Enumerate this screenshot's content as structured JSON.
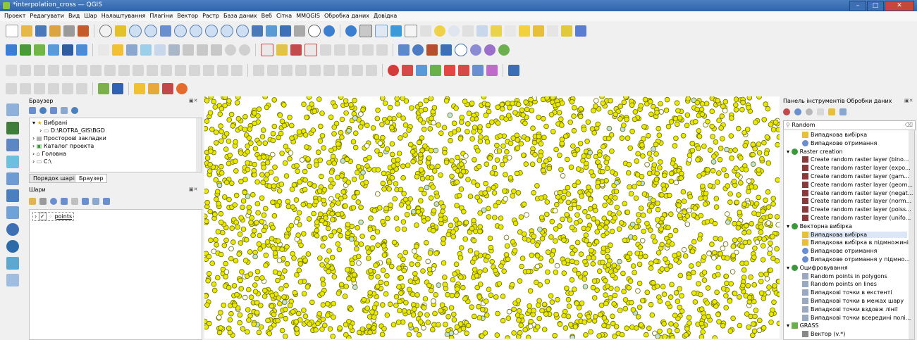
{
  "window": {
    "title": "*interpolation_cross — QGIS",
    "minimize": "–",
    "maximize": "□",
    "close": "✕"
  },
  "menu": [
    "Проект",
    "Редагувати",
    "Вид",
    "Шар",
    "Налаштування",
    "Плагіни",
    "Вектор",
    "Растр",
    "База даних",
    "Веб",
    "Сітка",
    "MMQGIS",
    "Обробка даних",
    "Довідка"
  ],
  "browser": {
    "title": "Браузер",
    "items": [
      "Вибрані",
      "D:\\ROTRA_GIS\\BGD",
      "Просторові закладки",
      "Каталог проекта",
      "Головна",
      "C:\\"
    ],
    "tabs": [
      "Порядок шарів",
      "Браузер"
    ]
  },
  "layers": {
    "title": "Шари",
    "items": [
      {
        "name": "points",
        "checked": "✓"
      }
    ]
  },
  "processing": {
    "title": "Панель інструментів Обробки даних",
    "search_value": "Random",
    "search_clear": "⌫",
    "rows": [
      {
        "text": "Випадкова вибірка",
        "level": 2,
        "icon": "vector-tool-icon"
      },
      {
        "text": "Випадкове отримання",
        "level": 2,
        "icon": "gear-icon"
      },
      {
        "text": "Raster creation",
        "level": 1,
        "icon": "group-icon"
      },
      {
        "text": "Create random raster layer (bino...",
        "level": 2,
        "icon": "raster-icon"
      },
      {
        "text": "Create random raster layer (expo...",
        "level": 2,
        "icon": "raster-icon"
      },
      {
        "text": "Create random raster layer (gam...",
        "level": 2,
        "icon": "raster-icon"
      },
      {
        "text": "Create random raster layer (geom...",
        "level": 2,
        "icon": "raster-icon"
      },
      {
        "text": "Create random raster layer (negat...",
        "level": 2,
        "icon": "raster-icon"
      },
      {
        "text": "Create random raster layer (norm...",
        "level": 2,
        "icon": "raster-icon"
      },
      {
        "text": "Create random raster layer (poiss...",
        "level": 2,
        "icon": "raster-icon"
      },
      {
        "text": "Create random raster layer (unifo...",
        "level": 2,
        "icon": "raster-icon"
      },
      {
        "text": "Векторна вибірка",
        "level": 1,
        "icon": "group-icon"
      },
      {
        "text": "Випадкова вибірка",
        "level": 2,
        "icon": "vector-tool-icon",
        "selected": true
      },
      {
        "text": "Випадкова вибірка в підмножині",
        "level": 2,
        "icon": "vector-tool-icon"
      },
      {
        "text": "Випадкове отримання",
        "level": 2,
        "icon": "gear-icon"
      },
      {
        "text": "Випадкове отримання у підмно...",
        "level": 2,
        "icon": "gear-icon"
      },
      {
        "text": "Оцифровування",
        "level": 1,
        "icon": "group-icon"
      },
      {
        "text": "Random points in polygons",
        "level": 2,
        "icon": "points-icon"
      },
      {
        "text": "Random points on lines",
        "level": 2,
        "icon": "points-icon"
      },
      {
        "text": "Випадкові точки в екстенті",
        "level": 2,
        "icon": "points-icon"
      },
      {
        "text": "Випадкові точки в межах шару",
        "level": 2,
        "icon": "points-icon"
      },
      {
        "text": "Випадкові точки вздовж лінії",
        "level": 2,
        "icon": "points-icon"
      },
      {
        "text": "Випадкові точки всередині полі...",
        "level": 2,
        "icon": "points-icon"
      },
      {
        "text": "GRASS",
        "level": 1,
        "icon": "grass-icon"
      },
      {
        "text": "Вектор (v.*)",
        "level": 2,
        "icon": "folder-icon"
      }
    ]
  },
  "colors": {
    "point_fill": "#e8e800",
    "point_stroke": "#6b6b00",
    "title_bar": "#3a6fb6",
    "accent": "#3874c8"
  }
}
